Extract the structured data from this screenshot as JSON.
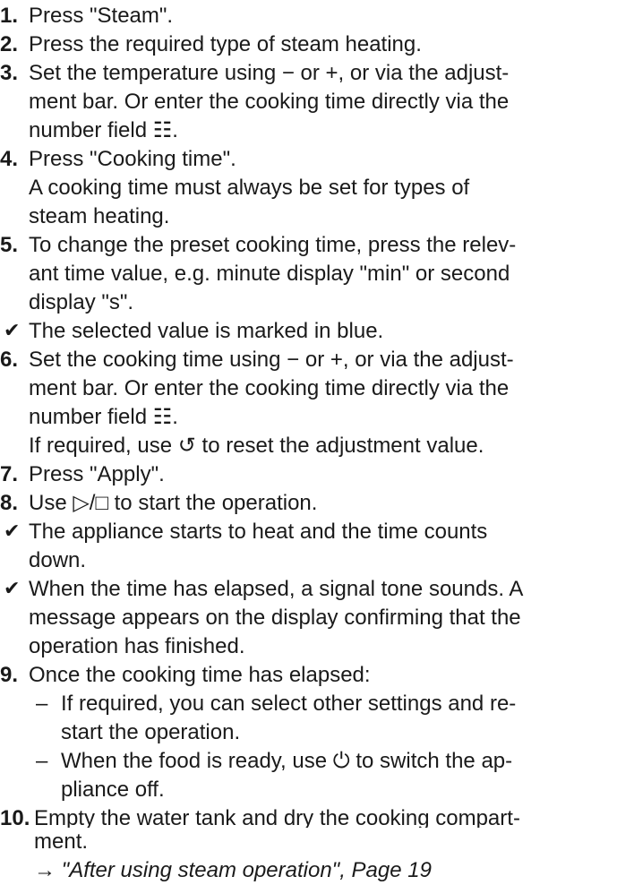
{
  "steps": [
    {
      "marker": "1.",
      "lines": [
        "Press \"Steam\"."
      ]
    },
    {
      "marker": "2.",
      "lines": [
        "Press the required type of steam heating."
      ]
    },
    {
      "marker": "3.",
      "lines": [
        "Set the temperature using − or +, or via the adjust-",
        "ment bar. Or enter the cooking time directly via the",
        "number field ☷."
      ]
    },
    {
      "marker": "4.",
      "lines": [
        "Press \"Cooking time\".",
        "A cooking time must always be set for types of",
        "steam heating."
      ]
    },
    {
      "marker": "5.",
      "lines": [
        "To change the preset cooking time, press the relev-",
        "ant time value, e.g. minute display \"min\" or second",
        "display \"s\"."
      ]
    },
    {
      "marker": "✔",
      "lines": [
        "The selected value is marked in blue."
      ]
    },
    {
      "marker": "6.",
      "lines": [
        "Set the cooking time using − or +, or via the adjust-",
        "ment bar. Or enter the cooking time directly via the",
        "number field ☷.",
        "If required, use ↺ to reset the adjustment value."
      ]
    },
    {
      "marker": "7.",
      "lines": [
        "Press \"Apply\"."
      ]
    },
    {
      "marker": "8.",
      "lines": [
        "Use ▷/□ to start the operation."
      ]
    },
    {
      "marker": "✔",
      "lines": [
        "The appliance starts to heat and the time counts",
        "down."
      ]
    },
    {
      "marker": "✔",
      "lines": [
        "When the time has elapsed, a signal tone sounds. A",
        "message appears on the display confirming that the",
        "operation has finished."
      ]
    },
    {
      "marker": "9.",
      "lines": [
        "Once the cooking time has elapsed:"
      ]
    },
    {
      "marker": "10.",
      "lines": [
        "Empty the water tank and dry the cooking compart-",
        "ment."
      ]
    }
  ],
  "substeps": [
    {
      "dash": "–",
      "lines": [
        "If required, you can select other settings and re-",
        "start the operation."
      ]
    },
    {
      "dash": "–",
      "lines": [
        "When the food is ready, use ⏻ to switch the ap-",
        "pliance off."
      ]
    }
  ],
  "reference": {
    "text": "→ \"After using steam operation\", Page 19"
  }
}
